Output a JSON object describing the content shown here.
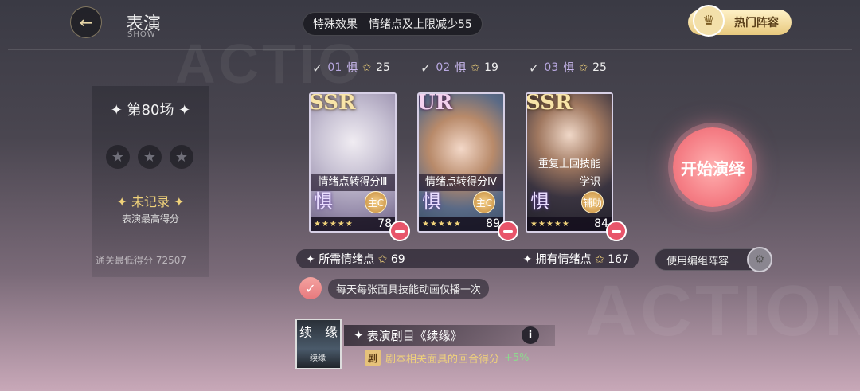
{
  "header": {
    "title": "表演",
    "subtitle": "SHOW",
    "back_icon": "arrow-left-icon"
  },
  "effect": {
    "label": "特殊效果",
    "value": "情绪点及上限减少55"
  },
  "hot_team": {
    "label": "热门阵容"
  },
  "scene": {
    "label": "第80场",
    "stars_total": 3,
    "stars_earned": 0,
    "record": "未记录",
    "best_label": "表演最高得分",
    "pass_label": "通关最低得分",
    "pass_score": "72507"
  },
  "slots": [
    {
      "check": "✓",
      "num": "01",
      "fear": "惧",
      "star_count": "25"
    },
    {
      "check": "✓",
      "num": "02",
      "fear": "惧",
      "star_count": "19"
    },
    {
      "check": "✓",
      "num": "03",
      "fear": "惧",
      "star_count": "25"
    }
  ],
  "cards": [
    {
      "rarity": "SSR",
      "skill": "情绪点转得分Ⅲ",
      "fear": "惧",
      "role": "主C",
      "level": "78",
      "stars": "★★★★★"
    },
    {
      "rarity": "UR",
      "skill": "情绪点转得分Ⅳ",
      "fear": "惧",
      "role": "主C",
      "level": "89",
      "stars": "★★★★★"
    },
    {
      "rarity": "SSR",
      "skill": "重复上回技能",
      "skill2": "学识",
      "fear": "惧",
      "role": "辅助",
      "level": "84",
      "stars": "★★★★★"
    }
  ],
  "points": {
    "required_label": "所需情绪点",
    "required_value": "69",
    "owned_label": "拥有情绪点",
    "owned_value": "167"
  },
  "use_team": {
    "label": "使用编组阵容"
  },
  "start_button": {
    "label": "开始演绎"
  },
  "checkbox": {
    "label": "每天每张面具技能动画仅播一次",
    "checked": true
  },
  "script": {
    "cover_char1": "续",
    "cover_char2": "缘",
    "cover_small": "续缘",
    "title": "表演剧目《续缘》",
    "info": "i",
    "bonus_tag": "剧",
    "bonus_text": "剧本相关面具的回合得分",
    "bonus_pct": "+5%"
  },
  "colors": {
    "accent_gold": "#f0d27a",
    "start_pink": "#f57f86",
    "remove_red": "#e8556a"
  }
}
